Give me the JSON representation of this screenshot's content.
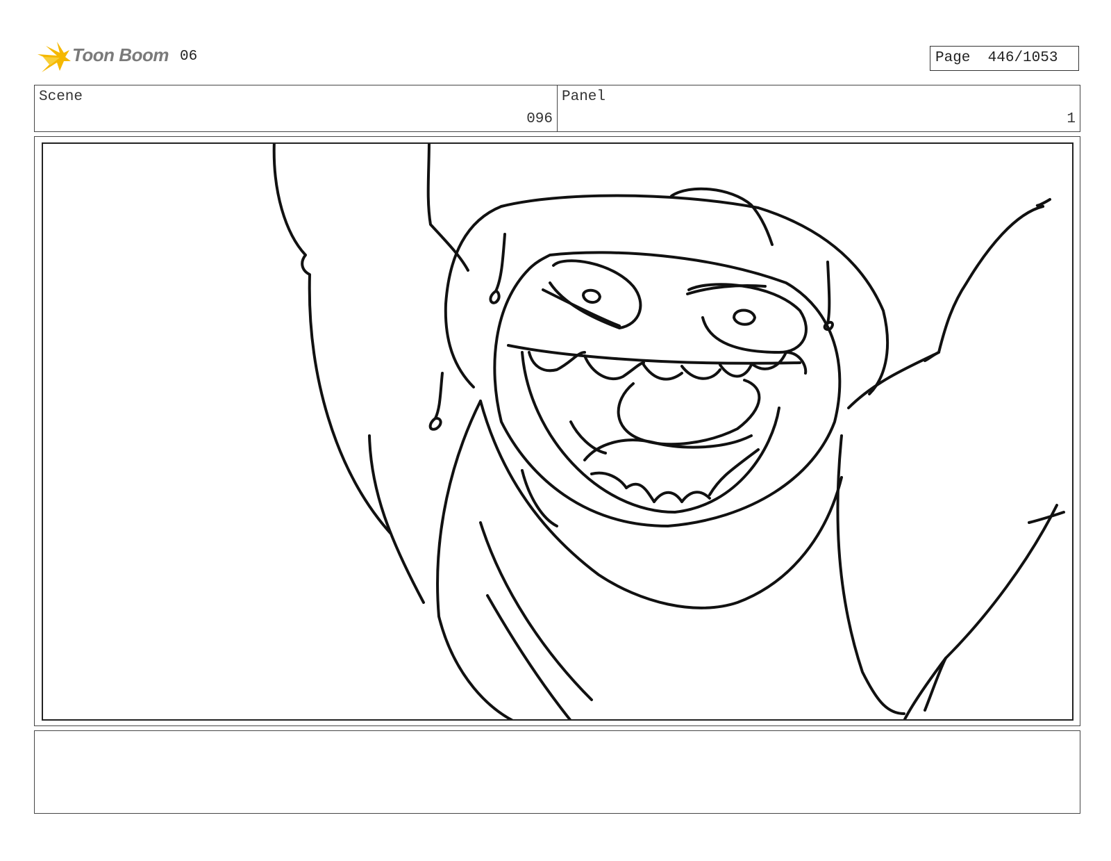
{
  "header": {
    "logo_text": "Toon Boom",
    "logo_icon": "burst-icon",
    "sequence": "06",
    "page_label": "Page",
    "page_value": "446/1053"
  },
  "info": {
    "scene_label": "Scene",
    "scene_value": "096",
    "panel_label": "Panel",
    "panel_value": "1"
  },
  "notes": {
    "text": ""
  },
  "colors": {
    "logo_accent": "#f5b800",
    "logo_text": "#7a7a7a",
    "border": "#444444"
  }
}
